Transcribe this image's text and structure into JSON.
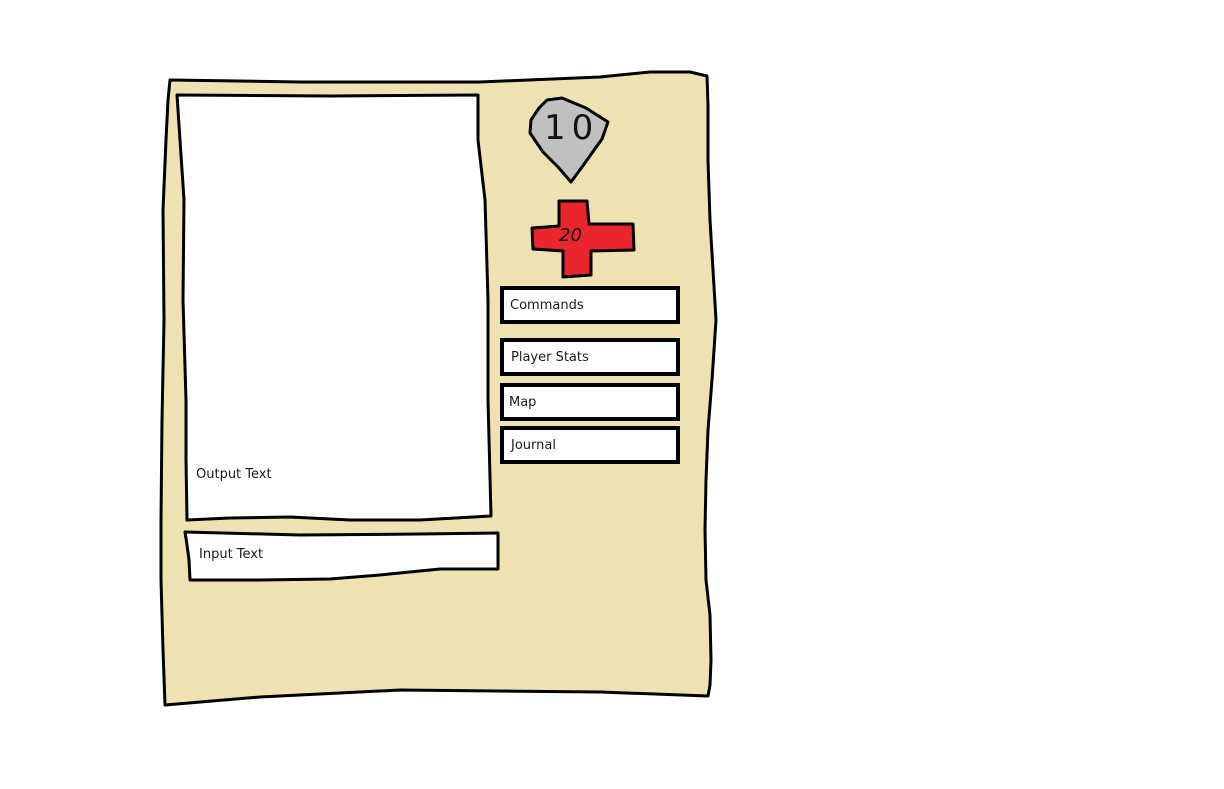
{
  "output_panel": {
    "label": "Output Text"
  },
  "input_field": {
    "label": "Input Text"
  },
  "armor_badge": {
    "value": "10",
    "icon": "armor-diamond-icon",
    "color": "#c0c0c0"
  },
  "health_badge": {
    "value": "20",
    "icon": "health-cross-icon",
    "color": "#e8262c"
  },
  "menu": {
    "items": [
      {
        "label": "Commands"
      },
      {
        "label": "Player Stats"
      },
      {
        "label": "Map"
      },
      {
        "label": "Journal"
      }
    ]
  },
  "colors": {
    "parchment": "#efe2b2",
    "outline": "#000000",
    "panel": "#ffffff"
  }
}
